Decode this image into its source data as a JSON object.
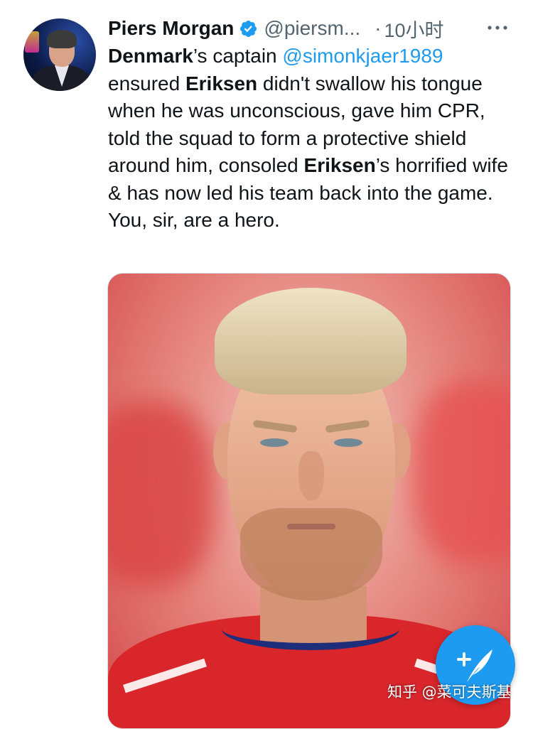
{
  "tweet": {
    "author": {
      "name": "Piers Morgan",
      "handle": "@piersm...",
      "verified": true,
      "avatar_icon": "profile-photo"
    },
    "separator": "·",
    "timestamp": "10小时",
    "more_icon": "ellipsis-icon",
    "text": {
      "seg1": "Denmark",
      "seg2": "’s captain ",
      "mention": "@simonkjaer1989",
      "seg3": " ensured ",
      "seg4": "Eriksen",
      "seg5": " didn't swallow his tongue when he was unconscious, gave him CPR, told the squad to form a protective shield around him, consoled ",
      "seg6": "Eriksen",
      "seg7": "’s horrified wife & has now led his team back into the game. You, sir, are a hero."
    },
    "media": {
      "type": "photo"
    }
  },
  "compose_button": {
    "icon": "compose-feather-icon"
  },
  "watermark": "知乎 @菜可夫斯基",
  "colors": {
    "accent": "#1d9bf0",
    "text": "#0f1419",
    "secondary": "#536471"
  }
}
